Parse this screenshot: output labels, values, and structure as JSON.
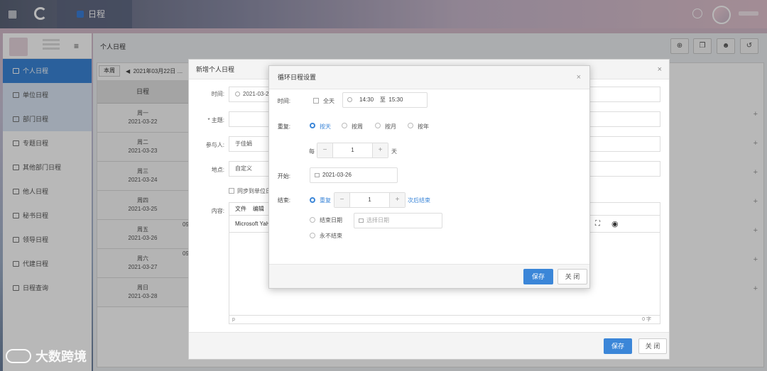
{
  "topbar": {
    "tab_label": "日程",
    "apps_icon": "grid-icon",
    "chat_icon": "chat-icon"
  },
  "sidebar": {
    "items": [
      {
        "label": "个人日程"
      },
      {
        "label": "单位日程"
      },
      {
        "label": "部门日程"
      },
      {
        "label": "专题日程"
      },
      {
        "label": "其他部门日程"
      },
      {
        "label": "他人日程"
      },
      {
        "label": "秘书日程"
      },
      {
        "label": "领导日程"
      },
      {
        "label": "代建日程"
      },
      {
        "label": "日程查询"
      }
    ]
  },
  "main": {
    "title": "个人日程",
    "week_button": "本周",
    "week_range": "2021年03月22日 …",
    "table_header": "日程",
    "days": [
      {
        "week": "周一",
        "date": "2021-03-22"
      },
      {
        "week": "周二",
        "date": "2021-03-23"
      },
      {
        "week": "周三",
        "date": "2021-03-24"
      },
      {
        "week": "周四",
        "date": "2021-03-25"
      },
      {
        "week": "周五",
        "date": "2021-03-26"
      },
      {
        "week": "周六",
        "date": "2021-03-27"
      },
      {
        "week": "周日",
        "date": "2021-03-28"
      }
    ],
    "row_09a": "09",
    "row_09b": "09",
    "plus": "+"
  },
  "outer_dialog": {
    "title": "新增个人日程",
    "time_label": "时间:",
    "time_value": "2021-03-2",
    "subject_label": "* 主题:",
    "participants_label": "参与人:",
    "participants_value": "于佳娟",
    "location_label": "地点:",
    "location_value": "自定义",
    "sync_label": "同步到单位日",
    "content_label": "内容:",
    "menu_file": "文件",
    "menu_edit": "编辑",
    "font_value": "Microsoft YaH",
    "word_count": "0 字",
    "editor_p": "p",
    "save": "保存",
    "close": "关 闭"
  },
  "inner_dialog": {
    "title": "循环日程设置",
    "time_label": "时间:",
    "allday": "全天",
    "start_time": "14:30",
    "to": "至",
    "end_time": "15:30",
    "repeat_label": "重复:",
    "repeat_options": [
      "按天",
      "按周",
      "按月",
      "按年"
    ],
    "every": "每",
    "every_value": "1",
    "day_unit": "天",
    "start_label": "开始:",
    "start_date": "2021-03-26",
    "end_label": "结束:",
    "end_repeat": "重复",
    "end_repeat_value": "1",
    "after_times": "次后结束",
    "end_date_opt": "结束日期",
    "date_placeholder": "选择日期",
    "never_end": "永不结束",
    "save": "保存",
    "close": "关 闭",
    "minus": "−",
    "plus": "+"
  },
  "watermark": "大数跨境"
}
